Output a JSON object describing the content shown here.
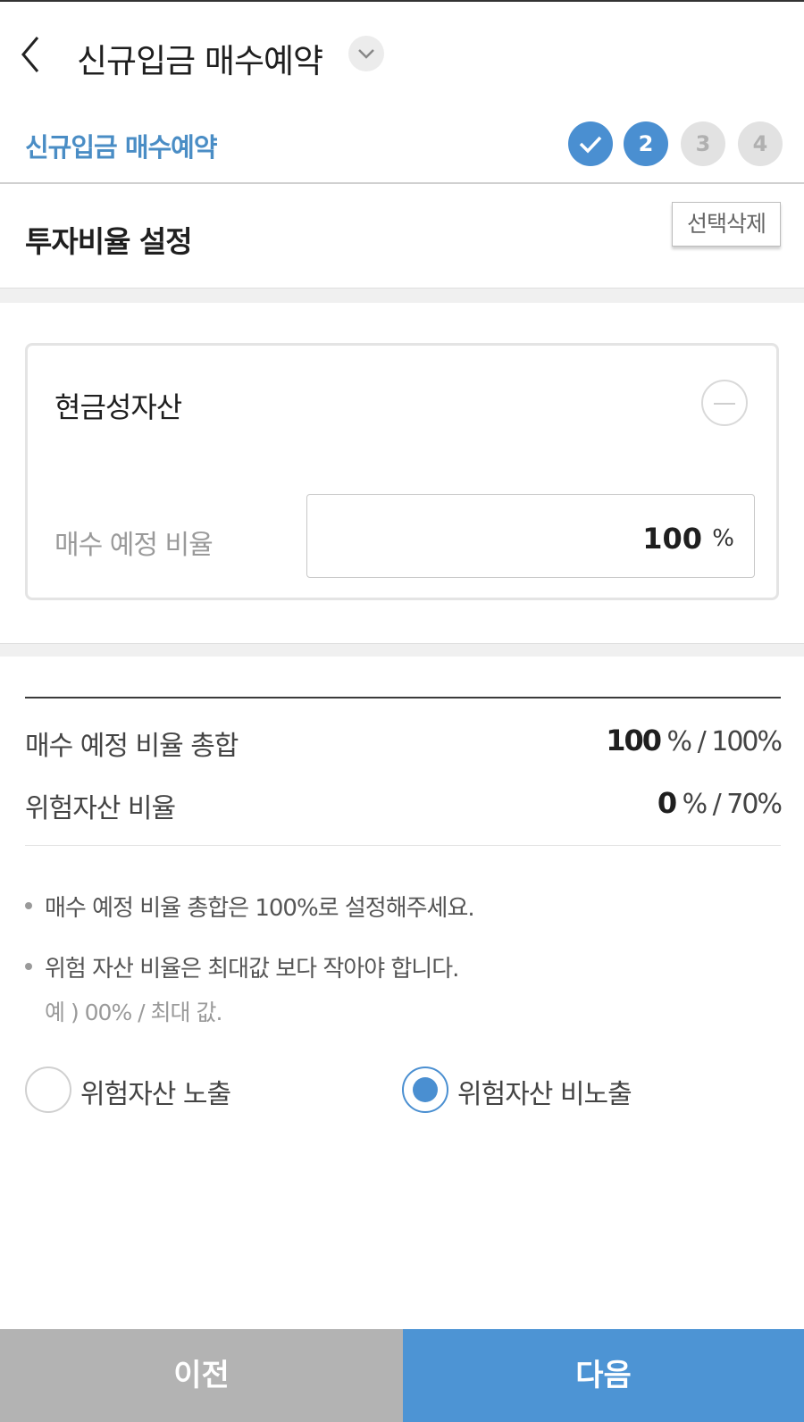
{
  "header": {
    "title": "신규입금 매수예약",
    "back_icon": "chevron-left-icon",
    "dropdown_icon": "chevron-down-icon"
  },
  "steps": {
    "title": "신규입금 매수예약",
    "items": [
      {
        "label": "",
        "state": "done",
        "icon": "check-icon"
      },
      {
        "label": "2",
        "state": "active"
      },
      {
        "label": "3",
        "state": "todo"
      },
      {
        "label": "4",
        "state": "todo"
      }
    ],
    "colors": {
      "accent": "#4a8fd1",
      "inactive": "#e2e2e2"
    }
  },
  "section": {
    "title": "투자비율 설정",
    "delete_selected_label": "선택삭제"
  },
  "asset_card": {
    "name": "현금성자산",
    "ratio_label": "매수 예정 비율",
    "ratio_value": "100",
    "ratio_unit": "%",
    "remove_icon": "minus-circle-icon"
  },
  "summary": {
    "total": {
      "label": "매수 예정 비율 총합",
      "value": "100",
      "suffix": "% / 100%"
    },
    "risk": {
      "label": "위험자산 비율",
      "value": "0",
      "suffix": "% / 70%"
    }
  },
  "notes": [
    "매수 예정 비율 총합은 100%로 설정해주세요.",
    "위험 자산 비율은 최대값 보다 작아야 합니다."
  ],
  "note_example": "예 ) 00% / 최대 값.",
  "risk_exposure": {
    "options": [
      {
        "label": "위험자산 노출",
        "selected": false
      },
      {
        "label": "위험자산 비노출",
        "selected": true
      }
    ]
  },
  "footer": {
    "prev_label": "이전",
    "next_label": "다음",
    "colors": {
      "prev": "#b3b3b3",
      "next": "#4d94d4"
    }
  }
}
